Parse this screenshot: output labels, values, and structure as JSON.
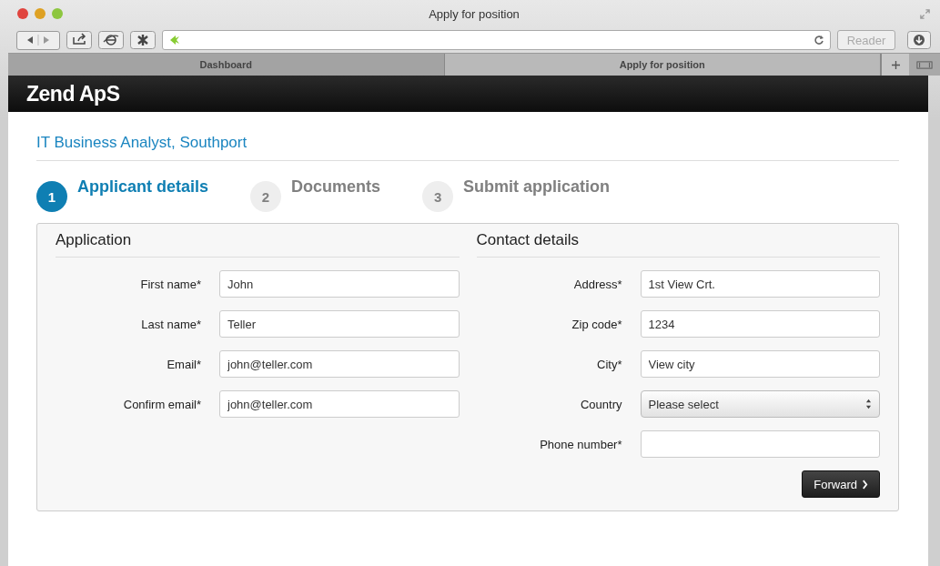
{
  "window": {
    "title": "Apply for position"
  },
  "toolbar": {
    "reader_label": "Reader"
  },
  "tabs": [
    {
      "label": "Dashboard",
      "selected": false
    },
    {
      "label": "Apply for position",
      "selected": true
    }
  ],
  "brand": "Zend ApS",
  "job_title": "IT Business Analyst, Southport",
  "steps": [
    {
      "number": "1",
      "label": "Applicant details",
      "selected": true
    },
    {
      "number": "2",
      "label": "Documents",
      "selected": false
    },
    {
      "number": "3",
      "label": "Submit application",
      "selected": false
    }
  ],
  "sections": [
    {
      "title": "Application",
      "fields": [
        {
          "label": "First name*",
          "kind": "text",
          "value": "John"
        },
        {
          "label": "Last name*",
          "kind": "text",
          "value": "Teller"
        },
        {
          "label": "Email*",
          "kind": "text",
          "value": "john@teller.com"
        },
        {
          "label": "Confirm email*",
          "kind": "text",
          "value": "john@teller.com"
        }
      ]
    },
    {
      "title": "Contact details",
      "fields": [
        {
          "label": "Address*",
          "kind": "text",
          "value": "1st View Crt."
        },
        {
          "label": "Zip code*",
          "kind": "text",
          "value": "1234"
        },
        {
          "label": "City*",
          "kind": "text",
          "value": "View city"
        },
        {
          "label": "Country",
          "kind": "select",
          "value": "Please select"
        },
        {
          "label": "Phone number*",
          "kind": "text"
        }
      ]
    }
  ],
  "forward_button": "Forward"
}
